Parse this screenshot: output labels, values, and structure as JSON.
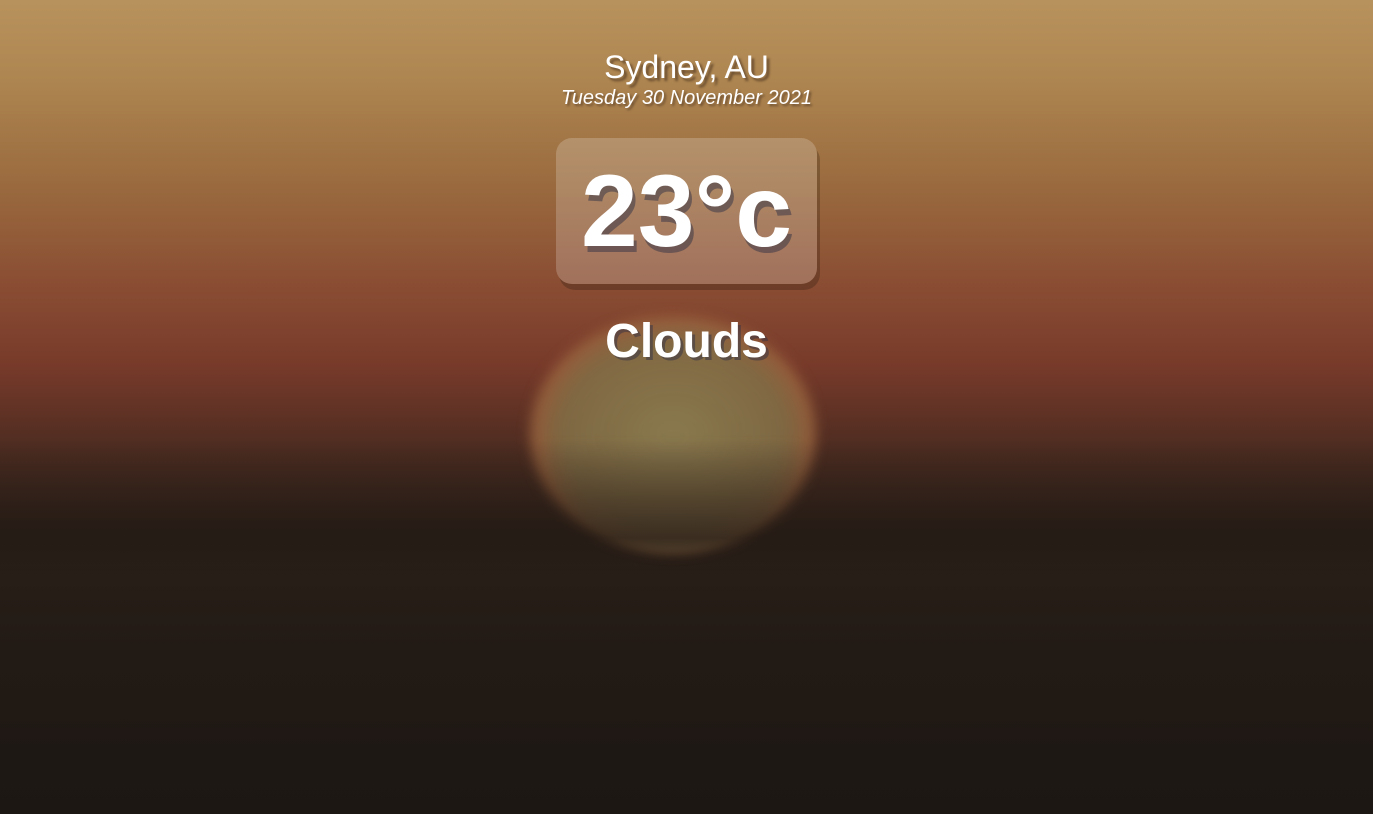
{
  "location": {
    "city": "Sydney, AU",
    "date": "Tuesday 30 November 2021"
  },
  "weather": {
    "temperature": "23°c",
    "condition": "Clouds"
  }
}
